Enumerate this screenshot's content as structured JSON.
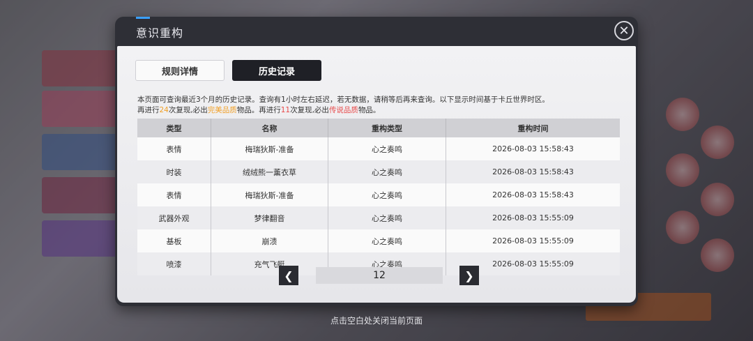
{
  "dialog": {
    "title": "意识重构",
    "close_icon": "close-icon"
  },
  "tabs": [
    {
      "label": "规则详情",
      "active": false
    },
    {
      "label": "历史记录",
      "active": true
    }
  ],
  "info": {
    "line1": "本页面可查询最近3个月的历史记录。查询有1小时左右延迟，若无数据，请稍等后再来查询。以下显示时间基于卡丘世界时区。",
    "line2_a": "再进行",
    "line2_num1": "24",
    "line2_b": "次复现,必出",
    "line2_q1": "完美品质",
    "line2_c": "物品。再进行",
    "line2_num2": "11",
    "line2_d": "次复现,必出",
    "line2_q2": "传说品质",
    "line2_e": "物品。"
  },
  "table": {
    "headers": [
      "类型",
      "名称",
      "重构类型",
      "重构时间"
    ],
    "rows": [
      {
        "type": "表情",
        "name": "梅瑞狄斯-准备",
        "name_color": "blue",
        "rebuild": "心之奏鸣",
        "time": "2026-08-03  15:58:43"
      },
      {
        "type": "时装",
        "name": "绒绒熊一薰衣草",
        "name_color": "blue",
        "rebuild": "心之奏鸣",
        "time": "2026-08-03  15:58:43"
      },
      {
        "type": "表情",
        "name": "梅瑞狄斯-准备",
        "name_color": "blue",
        "rebuild": "心之奏鸣",
        "time": "2026-08-03  15:58:43"
      },
      {
        "type": "武器外观",
        "name": "梦律翻音",
        "name_color": "red",
        "rebuild": "心之奏鸣",
        "time": "2026-08-03  15:55:09"
      },
      {
        "type": "基板",
        "name": "崩溃",
        "name_color": "blue",
        "rebuild": "心之奏鸣",
        "time": "2026-08-03  15:55:09"
      },
      {
        "type": "喷漆",
        "name": "充气飞艇",
        "name_color": "blue",
        "rebuild": "心之奏鸣",
        "time": "2026-08-03  15:55:09"
      }
    ]
  },
  "pager": {
    "page": "12",
    "prev_icon": "chevron-left-icon",
    "next_icon": "chevron-right-icon"
  },
  "hint": "点击空白处关闭当前页面",
  "colors": {
    "accent_blue": "#3a6fd0",
    "legend_red": "#d83030",
    "highlight_orange": "#f0a028"
  }
}
